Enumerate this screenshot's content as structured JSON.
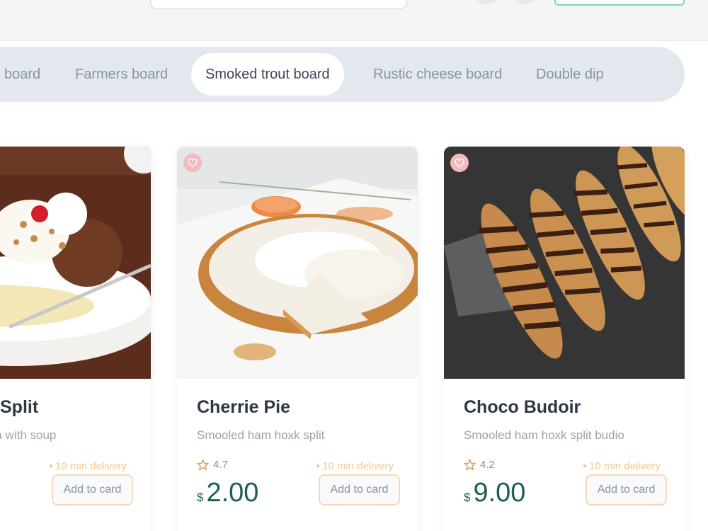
{
  "colors": {
    "accent_green": "#1c5e55",
    "tab_bar_bg": "#e3e8ef",
    "delivery_orange": "#f3c98e",
    "button_border": "#f6d9b6",
    "favorite_pink": "#f6b9be"
  },
  "tabs": [
    {
      "label": "board",
      "active": false
    },
    {
      "label": "Farmers board",
      "active": false
    },
    {
      "label": "Smoked trout board",
      "active": true
    },
    {
      "label": "Rustic cheese board",
      "active": false
    },
    {
      "label": "Double dip",
      "active": false
    }
  ],
  "cards": [
    {
      "title": "Split",
      "description": "nana with soup",
      "delivery": "10 min delivery",
      "button": "Add to card",
      "image_icon": "banana-split-photo"
    },
    {
      "title": "Cherrie Pie",
      "description": "Smooled ham hoxk split",
      "rating": "4.7",
      "delivery": "10 min delivery",
      "currency": "$",
      "price": "2.00",
      "button": "Add to card",
      "image_icon": "meringue-pie-photo"
    },
    {
      "title": "Choco Budoir",
      "description": "Smooled ham hoxk split budio",
      "rating": "4.2",
      "delivery": "10 min delivery",
      "currency": "$",
      "price": "9.00",
      "button": "Add to card",
      "image_icon": "chocolate-eclair-photo"
    }
  ]
}
